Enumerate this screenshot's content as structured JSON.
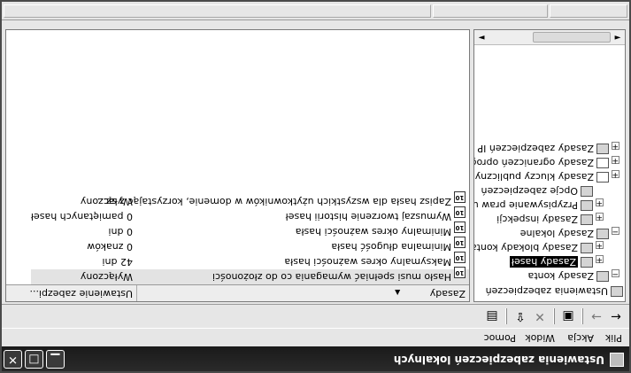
{
  "window": {
    "title": "Ustawienia zabezpieczeń lokalnych",
    "minimize": "▁",
    "maximize": "□",
    "close": "✕"
  },
  "menu": [
    "Plik",
    "Akcja",
    "Widok",
    "Pomoc"
  ],
  "toolbar": {
    "icons": [
      "back-arrow-icon",
      "forward-arrow-icon",
      "show-hide-tree-icon",
      "delete-icon",
      "export-list-icon",
      "properties-icon"
    ],
    "back": "←",
    "forward": "→",
    "show_hide": "▣",
    "delete": "✕",
    "export": "⇪",
    "properties": "▤"
  },
  "tree": {
    "root": "Ustawienia zabezpieczeń",
    "items": [
      {
        "label": "Zasady konta",
        "level": 1,
        "expander": "−"
      },
      {
        "label": "Zasady haseł",
        "level": 2,
        "expander": "+",
        "selected": true
      },
      {
        "label": "Zasady blokady konta",
        "level": 2,
        "expander": "+"
      },
      {
        "label": "Zasady lokalne",
        "level": 1,
        "expander": "−"
      },
      {
        "label": "Zasady inspekcji",
        "level": 2,
        "expander": "+"
      },
      {
        "label": "Przypisywanie praw uż",
        "level": 2,
        "expander": "+"
      },
      {
        "label": "Opcje zabezpieczeń",
        "level": 2,
        "expander": ""
      },
      {
        "label": "Zasady kluczy publicznych",
        "level": 1,
        "expander": "+"
      },
      {
        "label": "Zasady ograniczeń oprogr",
        "level": 1,
        "expander": "+"
      },
      {
        "label": "Zasady zabezpieczeń IP w",
        "level": 1,
        "expander": "+"
      }
    ],
    "scroll_left": "◄",
    "scroll_right": "►"
  },
  "list": {
    "columns": [
      "Zasady",
      "Ustawienie zabezpi..."
    ],
    "sort_indicator": "▲",
    "rows": [
      {
        "name": "Hasło musi spełniać wymagania co do złożoności",
        "value": "Wyłączony",
        "selected": true
      },
      {
        "name": "Maksymalny okres ważności hasła",
        "value": "42 dni"
      },
      {
        "name": "Minimalna długość hasła",
        "value": "0 znaków"
      },
      {
        "name": "Minimalny okres ważności hasła",
        "value": "0 dni"
      },
      {
        "name": "Wymuszaj tworzenie historii haseł",
        "value": "0 pamiętanych haseł"
      },
      {
        "name": "Zapisz hasła dla wszystkich użytkowników w domenie, korzystając z sz...",
        "value": "Wyłączony"
      }
    ],
    "row_icon_text": "10\n01"
  }
}
